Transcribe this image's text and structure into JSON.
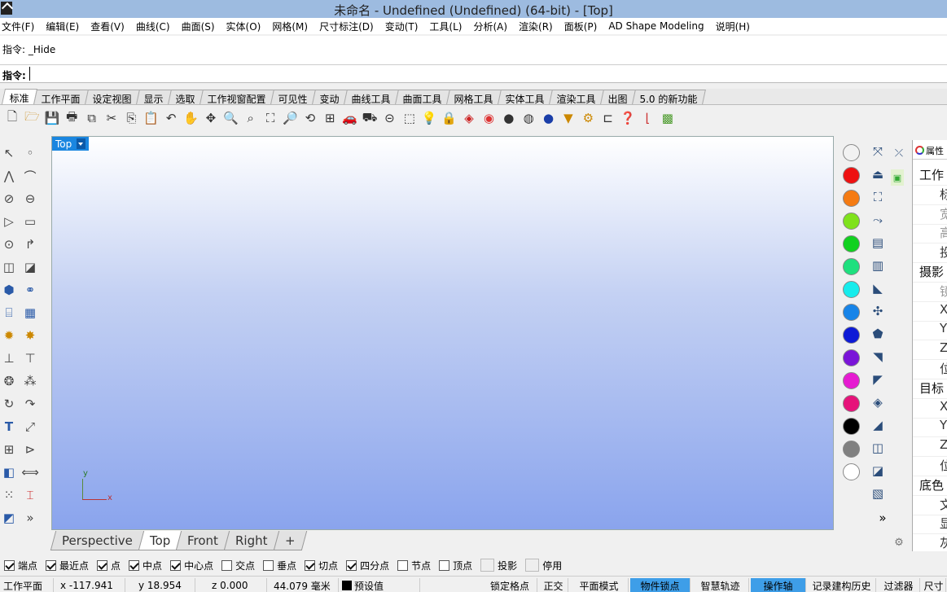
{
  "window": {
    "title": "未命名 - Undefined (Undefined) (64-bit) - [Top]"
  },
  "menu": [
    "文件(F)",
    "编辑(E)",
    "查看(V)",
    "曲线(C)",
    "曲面(S)",
    "实体(O)",
    "网格(M)",
    "尺寸标注(D)",
    "变动(T)",
    "工具(L)",
    "分析(A)",
    "渲染(R)",
    "面板(P)",
    "AD Shape Modeling",
    "说明(H)"
  ],
  "command": {
    "history": "指令: _Hide",
    "prompt_label": "指令:",
    "value": ""
  },
  "toolbar_tabs": [
    {
      "label": "标准",
      "active": true
    },
    {
      "label": "工作平面"
    },
    {
      "label": "设定视图"
    },
    {
      "label": "显示"
    },
    {
      "label": "选取"
    },
    {
      "label": "工作视窗配置"
    },
    {
      "label": "可见性"
    },
    {
      "label": "变动"
    },
    {
      "label": "曲线工具"
    },
    {
      "label": "曲面工具"
    },
    {
      "label": "网格工具"
    },
    {
      "label": "实体工具"
    },
    {
      "label": "渲染工具"
    },
    {
      "label": "出图"
    },
    {
      "label": "5.0 的新功能"
    }
  ],
  "viewport": {
    "title": "Top",
    "axis_x": "x",
    "axis_y": "y"
  },
  "view_tabs": [
    {
      "label": "Perspective"
    },
    {
      "label": "Top",
      "active": true
    },
    {
      "label": "Front"
    },
    {
      "label": "Right"
    },
    {
      "label": "+"
    }
  ],
  "colors": [
    "#f2f2f2",
    "#ee1111",
    "#f57b12",
    "#7fe21c",
    "#11d11f",
    "#1ee07e",
    "#17ecec",
    "#1784e8",
    "#0d1ad6",
    "#7a14d8",
    "#e61bd1",
    "#e6137a",
    "#000000",
    "#808080",
    "#ffffff"
  ],
  "properties": {
    "tab_label": "属性",
    "rows": [
      {
        "t": "工作",
        "h": true
      },
      {
        "t": "标"
      },
      {
        "t": "宽",
        "grey": true
      },
      {
        "t": "高",
        "grey": true
      },
      {
        "t": "投"
      },
      {
        "t": "摄影",
        "h": true
      },
      {
        "t": "镜",
        "grey": true
      },
      {
        "t": "X"
      },
      {
        "t": "Y"
      },
      {
        "t": "Z"
      },
      {
        "t": "位"
      },
      {
        "t": "目标",
        "h": true
      },
      {
        "t": "X"
      },
      {
        "t": "Y"
      },
      {
        "t": "Z"
      },
      {
        "t": "位"
      },
      {
        "t": "底色",
        "h": true
      },
      {
        "t": "文"
      },
      {
        "t": "显"
      },
      {
        "t": "灰"
      }
    ]
  },
  "osnaps": [
    {
      "label": "端点",
      "on": true
    },
    {
      "label": "最近点",
      "on": true
    },
    {
      "label": "点",
      "on": true
    },
    {
      "label": "中点",
      "on": true
    },
    {
      "label": "中心点",
      "on": true
    },
    {
      "label": "交点",
      "on": false
    },
    {
      "label": "垂点",
      "on": false
    },
    {
      "label": "切点",
      "on": true
    },
    {
      "label": "四分点",
      "on": true
    },
    {
      "label": "节点",
      "on": false
    },
    {
      "label": "顶点",
      "on": false
    },
    {
      "label": "投影",
      "disabled": true
    },
    {
      "label": "停用",
      "disabled": true
    }
  ],
  "status": {
    "cplane": "工作平面",
    "x": "x -117.941",
    "y": "y 18.954",
    "z": "z 0.000",
    "unit": "44.079 毫米",
    "layer": "预设值",
    "toggles": [
      {
        "label": "锁定格点"
      },
      {
        "label": "正交"
      },
      {
        "label": "平面模式"
      },
      {
        "label": "物件锁点",
        "hl": true
      },
      {
        "label": "智慧轨迹"
      },
      {
        "label": "操作轴",
        "hl": true
      },
      {
        "label": "记录建构历史"
      },
      {
        "label": "过滤器"
      },
      {
        "label": "尺寸"
      }
    ]
  }
}
